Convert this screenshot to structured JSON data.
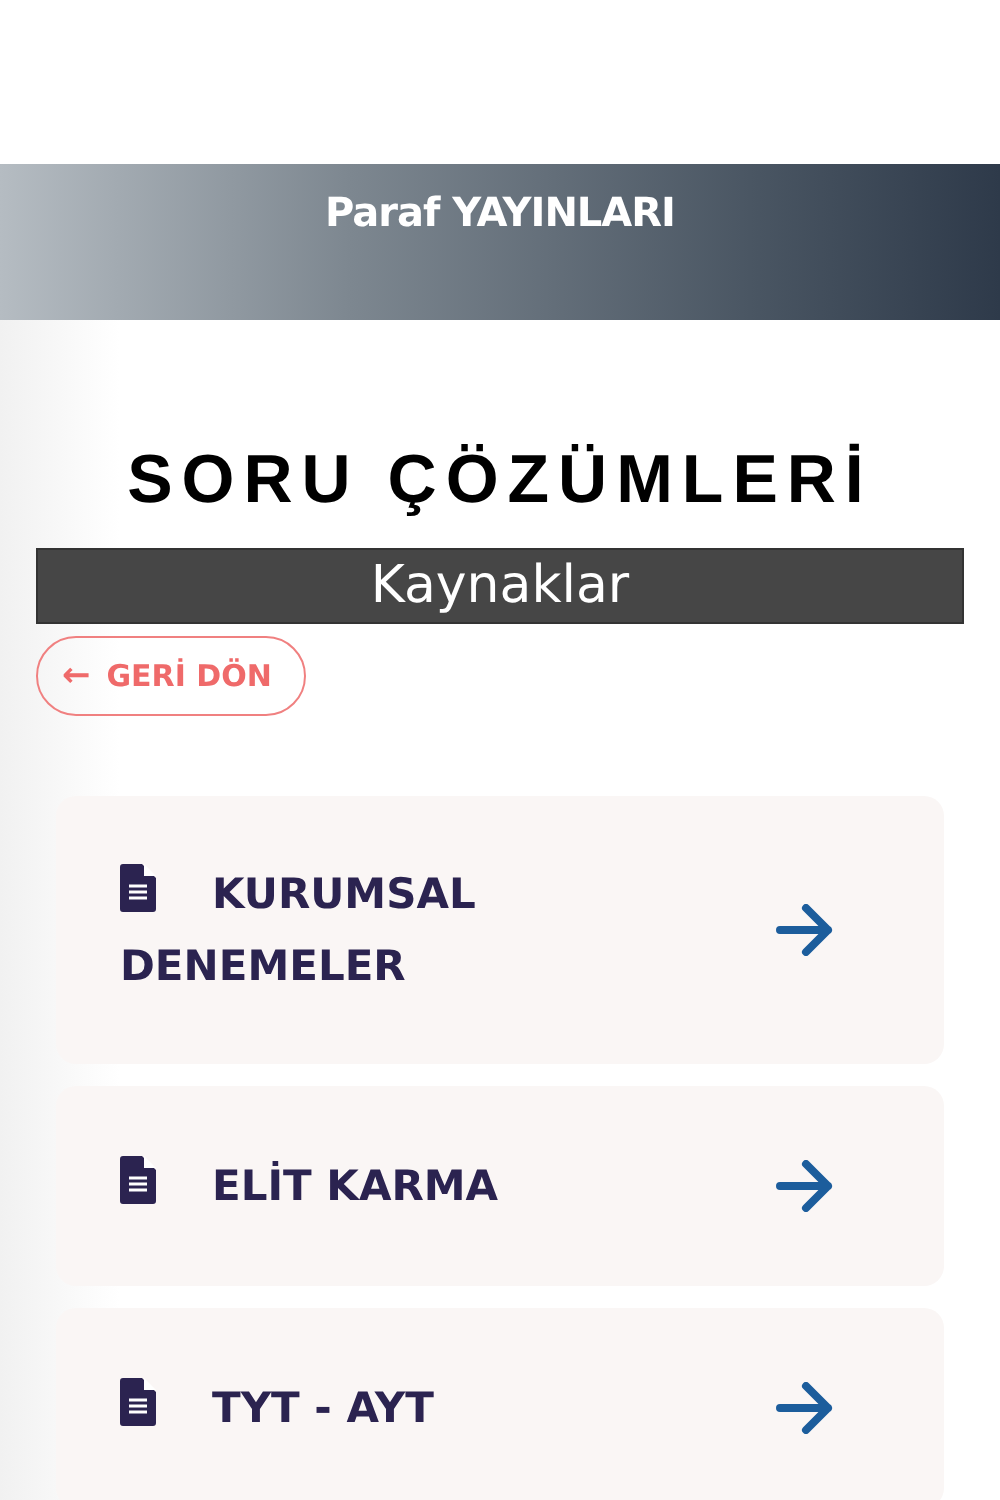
{
  "header": {
    "title": "Paraf YAYINLARI"
  },
  "heading": "SORU ÇÖZÜMLERİ",
  "subheading": "Kaynaklar",
  "back_button": {
    "icon": "←",
    "label": "GERİ DÖN"
  },
  "resources": [
    {
      "title": "KURUMSAL DENEMELER"
    },
    {
      "title": "ELİT KARMA"
    },
    {
      "title": "TYT - AYT"
    }
  ]
}
